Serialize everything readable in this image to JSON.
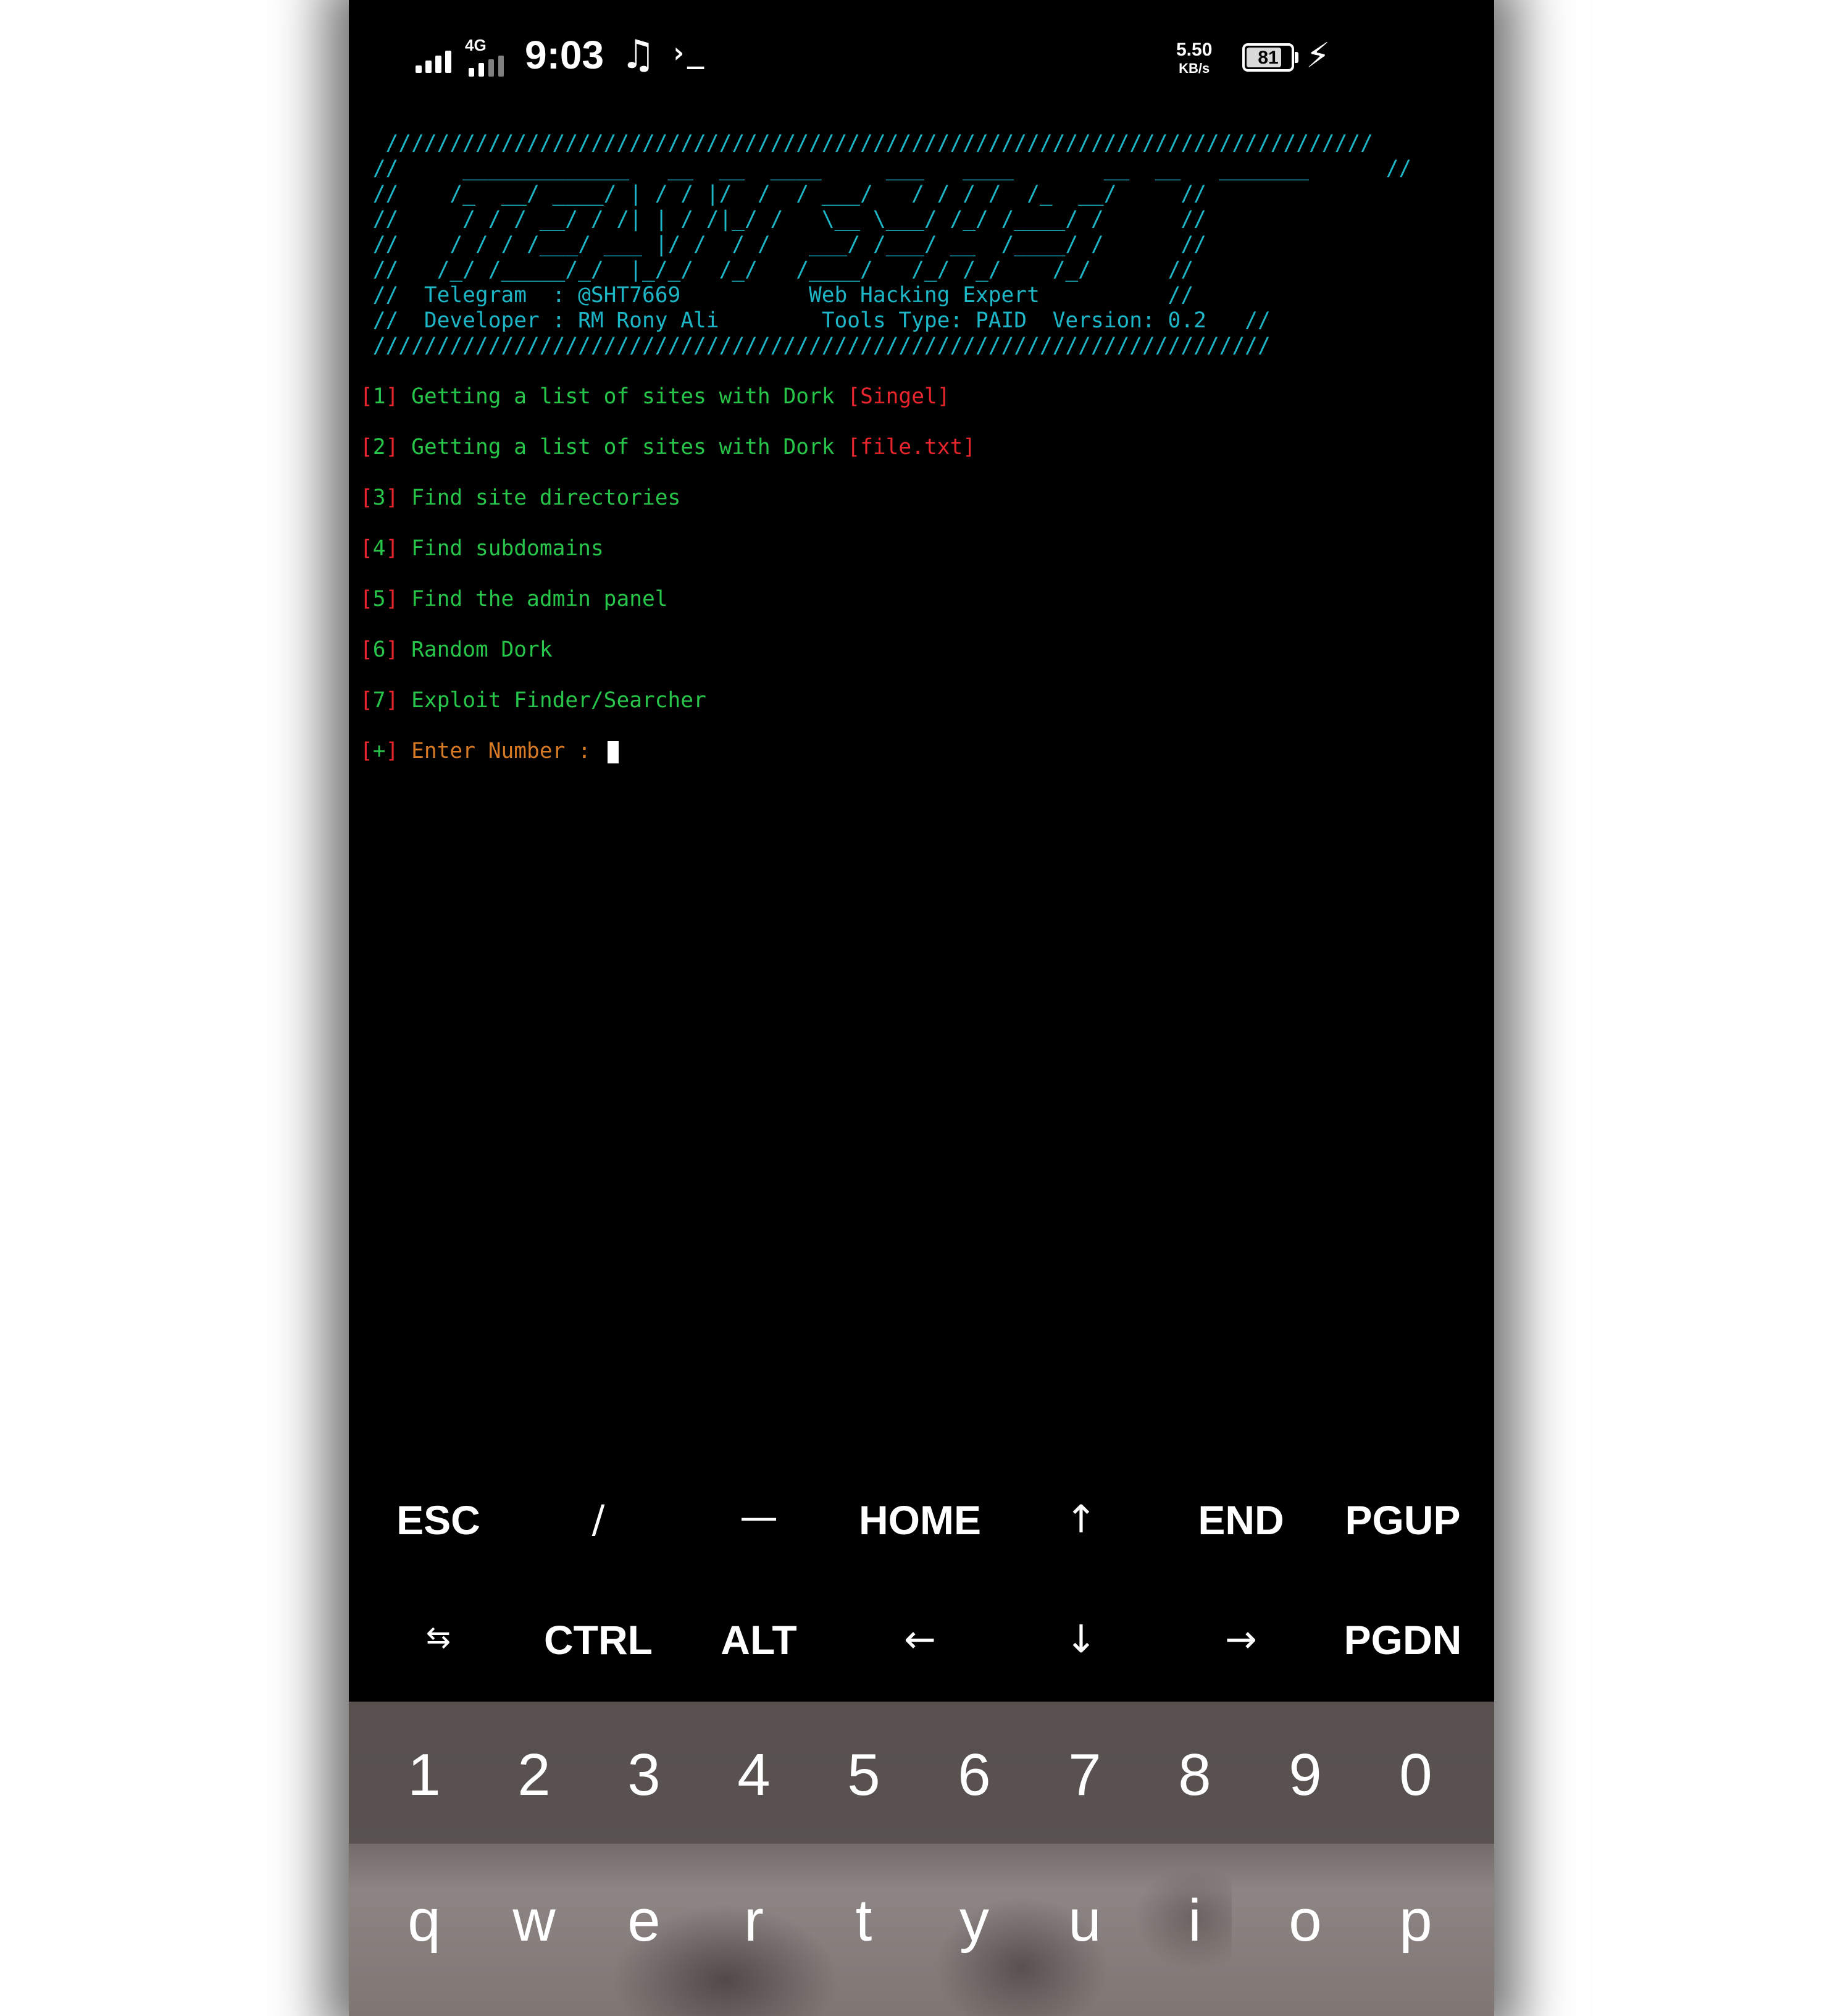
{
  "status_bar": {
    "network": "4G",
    "time": "9:03",
    "music_icon": "music-note-icon",
    "terminal_icon": "terminal-prompt-icon",
    "terminal_glyph": "›_",
    "speed_value": "5.50",
    "speed_unit": "KB/s",
    "battery": "81",
    "battery_level": 0.81,
    "charging_icon": "bolt-icon"
  },
  "terminal": {
    "banner": [
      "  /////////////////////////////////////////////////////////////////////////////",
      " //     _____________   __  __  ____     ___   ____       __  __   _______      //",
      " //    /_  __/ ____/ | / / |/  /  / ___/   / / / /  /_  __/     //",
      " //     / / / __/ / /| | / /|_/ /   \\__ \\___/ /_/ /____/ /      //",
      " //    / / / /___/ ___ |/ /  / /   ___/ /___/ __  /____/ /      //",
      " //   /_/ /_____/_/  |_/_/  /_/   /____/   /_/ /_/    /_/      //",
      " //  Telegram  : @SHT7669          Web Hacking Expert          //",
      " //  Developer : RM Rony Ali        Tools Type: PAID  Version: 0.2   //",
      " //////////////////////////////////////////////////////////////////////"
    ],
    "menu": [
      {
        "num": "1",
        "text": "Getting a list of sites with Dork",
        "tag": "[Singel]"
      },
      {
        "num": "2",
        "text": "Getting a list of sites with Dork",
        "tag": "[file.txt]"
      },
      {
        "num": "3",
        "text": "Find site directories",
        "tag": ""
      },
      {
        "num": "4",
        "text": "Find subdomains",
        "tag": ""
      },
      {
        "num": "5",
        "text": "Find the admin panel",
        "tag": ""
      },
      {
        "num": "6",
        "text": "Random Dork",
        "tag": ""
      },
      {
        "num": "7",
        "text": "Exploit Finder/Searcher",
        "tag": ""
      }
    ],
    "prompt_mark": "+",
    "prompt_text": "Enter Number : "
  },
  "extra_keys": {
    "row1": [
      "ESC",
      "/",
      "—",
      "HOME",
      "↑",
      "END",
      "PGUP"
    ],
    "row2": [
      "⇆",
      "CTRL",
      "ALT",
      "←",
      "↓",
      "→",
      "PGDN"
    ]
  },
  "keyboard": {
    "numbers": [
      "1",
      "2",
      "3",
      "4",
      "5",
      "6",
      "7",
      "8",
      "9",
      "0"
    ],
    "letters": [
      "q",
      "w",
      "e",
      "r",
      "t",
      "y",
      "u",
      "i",
      "o",
      "p"
    ]
  },
  "colors": {
    "banner": "#1db6c6",
    "bracket": "#e8242c",
    "menu_text": "#27c54a",
    "prompt": "#d77a26",
    "background": "#000000"
  }
}
